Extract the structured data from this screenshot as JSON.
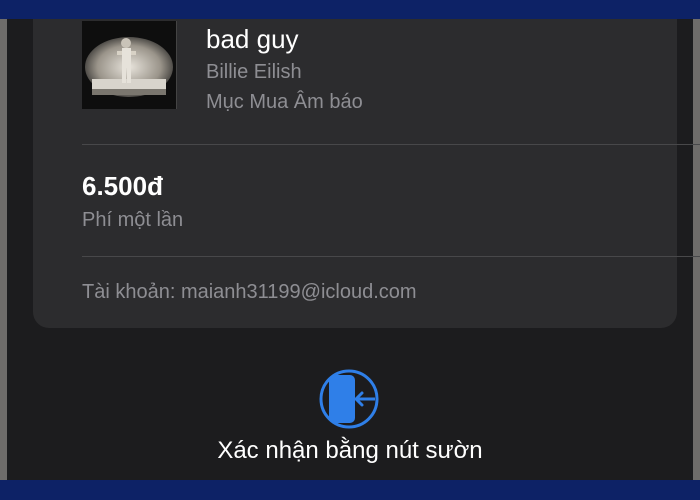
{
  "item": {
    "title": "bad guy",
    "artist": "Billie Eilish",
    "category": "Mục Mua Âm báo",
    "artwork_icon": "album-cover"
  },
  "price": {
    "amount": "6.500đ",
    "note": "Phí một lần"
  },
  "account": {
    "text": "Tài khoản: maianh31199@icloud.com"
  },
  "confirm": {
    "icon": "side-button-icon",
    "label": "Xác nhận bằng nút sườn"
  },
  "colors": {
    "accent": "#2f7fe8",
    "frame": "#0d2266",
    "card": "#2c2c2e",
    "sheet": "#1c1c1e"
  }
}
